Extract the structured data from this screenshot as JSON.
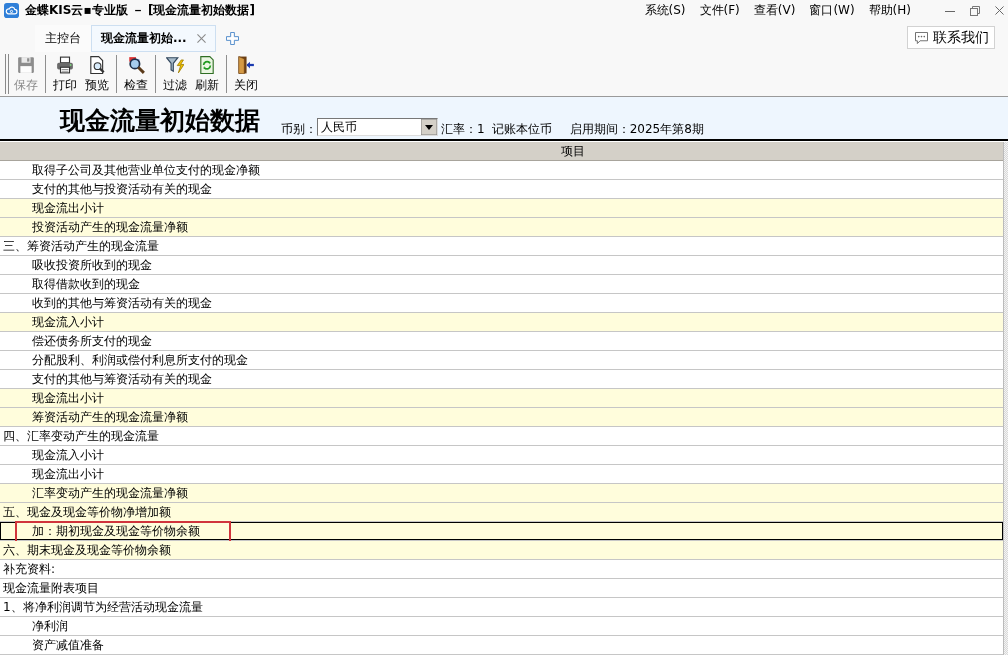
{
  "window": {
    "title": "金蝶KIS云▪专业版 － [现金流量初始数据]"
  },
  "menu": [
    "系统(S)",
    "文件(F)",
    "查看(V)",
    "窗口(W)",
    "帮助(H)"
  ],
  "tabs": [
    {
      "label": "主控台",
      "selected": false,
      "closable": false
    },
    {
      "label": "现金流量初始...",
      "selected": true,
      "closable": true
    }
  ],
  "contact_button": {
    "label": "联系我们"
  },
  "toolbar": [
    [
      {
        "kind": "save",
        "label": "保存",
        "disabled": true
      }
    ],
    [
      {
        "kind": "print",
        "label": "打印",
        "disabled": false
      },
      {
        "kind": "preview",
        "label": "预览",
        "disabled": false
      }
    ],
    [
      {
        "kind": "check",
        "label": "检查",
        "disabled": false
      }
    ],
    [
      {
        "kind": "filter",
        "label": "过滤",
        "disabled": false
      },
      {
        "kind": "refresh",
        "label": "刷新",
        "disabled": false
      }
    ],
    [
      {
        "kind": "close",
        "label": "关闭",
        "disabled": false
      }
    ]
  ],
  "report": {
    "title": "现金流量初始数据",
    "currency_label": "币别：",
    "currency": "人民币",
    "rate_label": "汇率：",
    "rate": "1",
    "base_currency": "记账本位币",
    "period_label": "启用期间：",
    "period": "2025年第8期"
  },
  "table": {
    "columns": [
      "项目"
    ],
    "rows": [
      {
        "kind": "item",
        "text": "取得子公司及其他营业单位支付的现金净额",
        "shaded": false,
        "selected": false,
        "annotated": false
      },
      {
        "kind": "item",
        "text": "支付的其他与投资活动有关的现金",
        "shaded": false,
        "selected": false,
        "annotated": false
      },
      {
        "kind": "item",
        "text": "现金流出小计",
        "shaded": true,
        "selected": false,
        "annotated": false
      },
      {
        "kind": "item",
        "text": "投资活动产生的现金流量净额",
        "shaded": true,
        "selected": false,
        "annotated": false
      },
      {
        "kind": "section",
        "text": "三、筹资活动产生的现金流量",
        "shaded": false,
        "selected": false,
        "annotated": false
      },
      {
        "kind": "item",
        "text": "吸收投资所收到的现金",
        "shaded": false,
        "selected": false,
        "annotated": false
      },
      {
        "kind": "item",
        "text": "取得借款收到的现金",
        "shaded": false,
        "selected": false,
        "annotated": false
      },
      {
        "kind": "item",
        "text": "收到的其他与筹资活动有关的现金",
        "shaded": false,
        "selected": false,
        "annotated": false
      },
      {
        "kind": "item",
        "text": "现金流入小计",
        "shaded": true,
        "selected": false,
        "annotated": false
      },
      {
        "kind": "item",
        "text": "偿还债务所支付的现金",
        "shaded": false,
        "selected": false,
        "annotated": false
      },
      {
        "kind": "item",
        "text": "分配股利、利润或偿付利息所支付的现金",
        "shaded": false,
        "selected": false,
        "annotated": false
      },
      {
        "kind": "item",
        "text": "支付的其他与筹资活动有关的现金",
        "shaded": false,
        "selected": false,
        "annotated": false
      },
      {
        "kind": "item",
        "text": "现金流出小计",
        "shaded": true,
        "selected": false,
        "annotated": false
      },
      {
        "kind": "item",
        "text": "筹资活动产生的现金流量净额",
        "shaded": true,
        "selected": false,
        "annotated": false
      },
      {
        "kind": "section",
        "text": "四、汇率变动产生的现金流量",
        "shaded": false,
        "selected": false,
        "annotated": false
      },
      {
        "kind": "item",
        "text": "现金流入小计",
        "shaded": false,
        "selected": false,
        "annotated": false
      },
      {
        "kind": "item",
        "text": "现金流出小计",
        "shaded": false,
        "selected": false,
        "annotated": false
      },
      {
        "kind": "item",
        "text": "汇率变动产生的现金流量净额",
        "shaded": true,
        "selected": false,
        "annotated": false
      },
      {
        "kind": "section",
        "text": "五、现金及现金等价物净增加额",
        "shaded": true,
        "selected": false,
        "annotated": false
      },
      {
        "kind": "item",
        "text": "加：期初现金及现金等价物余额",
        "shaded": true,
        "selected": true,
        "annotated": true
      },
      {
        "kind": "section",
        "text": "六、期末现金及现金等价物余额",
        "shaded": true,
        "selected": false,
        "annotated": false
      },
      {
        "kind": "section",
        "text": "补充资料:",
        "shaded": false,
        "selected": false,
        "annotated": false
      },
      {
        "kind": "section",
        "text": "现金流量附表项目",
        "shaded": false,
        "selected": false,
        "annotated": false
      },
      {
        "kind": "section",
        "text": "1、将净利润调节为经营活动现金流量",
        "shaded": false,
        "selected": false,
        "annotated": false
      },
      {
        "kind": "item",
        "text": "净利润",
        "shaded": false,
        "selected": false,
        "annotated": false
      },
      {
        "kind": "item",
        "text": "资产减值准备",
        "shaded": false,
        "selected": false,
        "annotated": false
      }
    ]
  }
}
